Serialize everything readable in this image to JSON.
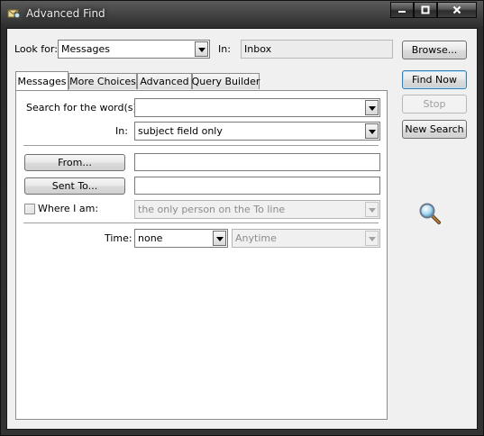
{
  "window": {
    "title": "Advanced Find",
    "caption": {
      "minimize": "▬",
      "maximize": "▢",
      "close": "X"
    }
  },
  "header": {
    "look_for_label": "Look for:",
    "look_for_value": "Messages",
    "in_label": "In:",
    "in_value": "Inbox"
  },
  "tabs": [
    {
      "label": "Messages",
      "active": true
    },
    {
      "label": "More Choices",
      "active": false
    },
    {
      "label": "Advanced",
      "active": false
    },
    {
      "label": "Query Builder",
      "active": false
    }
  ],
  "form": {
    "search_words_label": "Search for the word(s):",
    "search_words_value": "",
    "in_label": "In:",
    "in_value": "subject field only",
    "from_button": "From...",
    "from_value": "",
    "sent_to_button": "Sent To...",
    "sent_to_value": "",
    "where_i_am_label": "Where I am:",
    "where_i_am_checked": false,
    "where_i_am_value": "the only person on the To line",
    "time_label": "Time:",
    "time_value": "none",
    "time_range_value": "Anytime"
  },
  "actions": {
    "browse": "Browse...",
    "find_now": "Find Now",
    "stop": "Stop",
    "new_search": "New Search"
  },
  "icons": {
    "app": "find-envelope-icon",
    "search": "magnifier-icon"
  },
  "colors": {
    "title_text": "#e8e8e8",
    "client_bg": "#f0f0f0",
    "default_button_border": "#3c7fb1",
    "disabled_text": "#8c8c8c"
  }
}
